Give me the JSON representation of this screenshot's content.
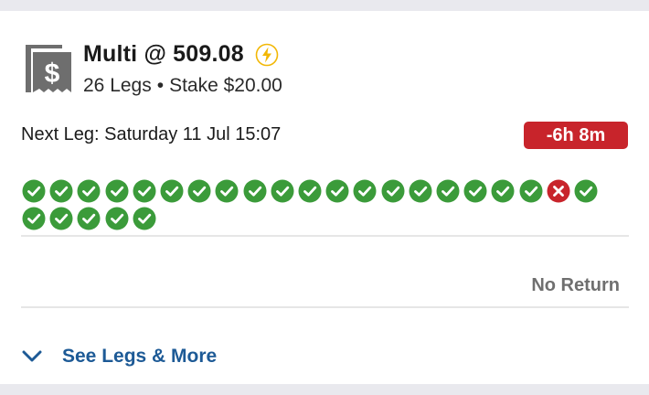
{
  "bet": {
    "title": "Multi @ 509.08",
    "legs_label": "26 Legs",
    "separator": "•",
    "stake_label": "Stake $20.00",
    "icon": "ticket-dollar-icon",
    "boost_icon": "lightning-bolt-icon"
  },
  "next_leg": {
    "text": "Next Leg: Saturday 11 Jul 15:07",
    "countdown": "-6h 8m"
  },
  "legs": {
    "statuses": [
      "won",
      "won",
      "won",
      "won",
      "won",
      "won",
      "won",
      "won",
      "won",
      "won",
      "won",
      "won",
      "won",
      "won",
      "won",
      "won",
      "won",
      "won",
      "won",
      "lost",
      "won",
      "won",
      "won",
      "won",
      "won",
      "won"
    ]
  },
  "result": {
    "label": "No Return"
  },
  "footer": {
    "see_more_label": "See Legs & More",
    "icon": "chevron-down-icon"
  },
  "colors": {
    "won": "#3b9b3a",
    "lost": "#c8242b",
    "countdown_bg": "#c8242b",
    "link": "#1d5a96",
    "bolt": "#f2b705"
  }
}
